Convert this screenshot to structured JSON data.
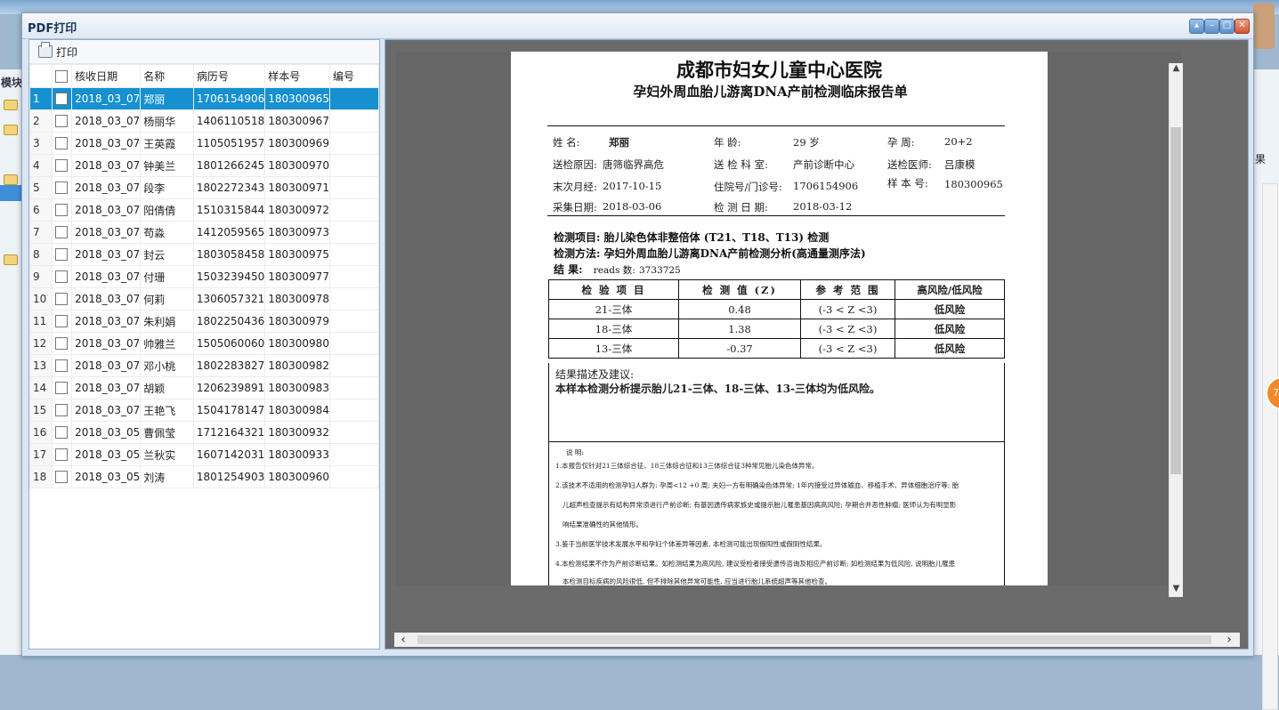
{
  "window": {
    "title": "PDF打印"
  },
  "background": {
    "module_label": "模块",
    "right_tab": "果",
    "badge": "78"
  },
  "toolbar": {
    "print_label": "打印"
  },
  "grid": {
    "columns": [
      "核收日期",
      "名称",
      "病历号",
      "样本号",
      "编号"
    ],
    "rows": [
      {
        "n": "1",
        "date": "2018_03_07",
        "name": "郑丽",
        "record": "1706154906",
        "sample": "180300965",
        "no": ""
      },
      {
        "n": "2",
        "date": "2018_03_07",
        "name": "杨丽华",
        "record": "1406110518",
        "sample": "180300967",
        "no": ""
      },
      {
        "n": "3",
        "date": "2018_03_07",
        "name": "王英霞",
        "record": "1105051957",
        "sample": "180300969",
        "no": ""
      },
      {
        "n": "4",
        "date": "2018_03_07",
        "name": "钟美兰",
        "record": "1801266245",
        "sample": "180300970",
        "no": ""
      },
      {
        "n": "5",
        "date": "2018_03_07",
        "name": "段李",
        "record": "1802272343",
        "sample": "180300971",
        "no": ""
      },
      {
        "n": "6",
        "date": "2018_03_07",
        "name": "阳倩倩",
        "record": "1510315844",
        "sample": "180300972",
        "no": ""
      },
      {
        "n": "7",
        "date": "2018_03_07",
        "name": "苟淼",
        "record": "1412059565",
        "sample": "180300973",
        "no": ""
      },
      {
        "n": "8",
        "date": "2018_03_07",
        "name": "封云",
        "record": "1803058458",
        "sample": "180300975",
        "no": ""
      },
      {
        "n": "9",
        "date": "2018_03_07",
        "name": "付珊",
        "record": "1503239450",
        "sample": "180300977",
        "no": ""
      },
      {
        "n": "10",
        "date": "2018_03_07",
        "name": "何莉",
        "record": "1306057321",
        "sample": "180300978",
        "no": ""
      },
      {
        "n": "11",
        "date": "2018_03_07",
        "name": "朱利娟",
        "record": "1802250436",
        "sample": "180300979",
        "no": ""
      },
      {
        "n": "12",
        "date": "2018_03_07",
        "name": "帅雅兰",
        "record": "1505060060",
        "sample": "180300980",
        "no": ""
      },
      {
        "n": "13",
        "date": "2018_03_07",
        "name": "邓小桃",
        "record": "1802283827",
        "sample": "180300982",
        "no": ""
      },
      {
        "n": "14",
        "date": "2018_03_07",
        "name": "胡颖",
        "record": "1206239891",
        "sample": "180300983",
        "no": ""
      },
      {
        "n": "15",
        "date": "2018_03_07",
        "name": "王艳飞",
        "record": "1504178147",
        "sample": "180300984",
        "no": ""
      },
      {
        "n": "16",
        "date": "2018_03_05",
        "name": "曹佩莹",
        "record": "1712164321",
        "sample": "180300932",
        "no": ""
      },
      {
        "n": "17",
        "date": "2018_03_05",
        "name": "兰秋实",
        "record": "1607142031",
        "sample": "180300933",
        "no": ""
      },
      {
        "n": "18",
        "date": "2018_03_05",
        "name": "刘涛",
        "record": "1801254903",
        "sample": "180300960",
        "no": ""
      }
    ]
  },
  "report": {
    "hospital": "成都市妇女儿童中心医院",
    "title": "孕妇外周血胎儿游离DNA产前检测临床报告单",
    "fields": {
      "name_label": "姓    名:",
      "name": "郑丽",
      "age_label": "年      龄:",
      "age": "29 岁",
      "gest_label": "孕    周:",
      "gest": "20+2",
      "reason_label": "送检原因:",
      "reason": "唐筛临界高危",
      "dept_label": "送 检 科 室:",
      "dept": "产前诊断中心",
      "doctor_label": "送检医师:",
      "doctor": "吕康模",
      "lmp_label": "末次月经:",
      "lmp": "2017-10-15",
      "inpatient_label": "住院号/门诊号:",
      "inpatient": "1706154906",
      "sample_label": "样 本 号:",
      "sample": "180300965",
      "collect_label": "采集日期:",
      "collect": "2018-03-06",
      "test_date_label": "检 测 日 期:",
      "test_date": "2018-03-12"
    },
    "project_label": "检测项目:",
    "project": "胎儿染色体非整倍体 (T21、T18、T13) 检测",
    "method_label": "检测方法:",
    "method": "孕妇外周血胎儿游离DNA产前检测分析(高通量测序法)",
    "result_label": "结      果:",
    "reads_label": "reads 数:",
    "reads": "3733725",
    "table": {
      "headers": [
        "检 验 项 目",
        "检 测 值 (Z)",
        "参 考 范 围",
        "高风险/低风险"
      ],
      "rows": [
        {
          "item": "21-三体",
          "value": "0.48",
          "range": "(-3 < Z <3)",
          "risk": "低风险"
        },
        {
          "item": "18-三体",
          "value": "1.38",
          "range": "(-3 < Z <3)",
          "risk": "低风险"
        },
        {
          "item": "13-三体",
          "value": "-0.37",
          "range": "(-3 < Z <3)",
          "risk": "低风险"
        }
      ]
    },
    "desc_label": "结果描述及建议:",
    "desc": "本样本检测分析提示胎儿21-三体、18-三体、13-三体均为低风险。",
    "notes_label": "说    明:",
    "notes": [
      "1.本报告仅针对21三体综合征、18三体综合征和13三体综合征3种常见胎儿染色体异常。",
      "2.该技术不适用的检测孕妇人群为: 孕周<12 +0 周; 夫妇一方有明确染色体异常; 1年内接受过异体输血、移植手术、异体细胞治疗等; 胎",
      "儿超声检查提示有结构异常须进行产前诊断; 有基因遗传病家族史或提示胎儿罹患基因病高风险; 孕期合并恶性肿瘤; 医师认为有明显影",
      "响结果准确性的其他情形。",
      "3.鉴于当前医学技术发展水平和孕妇个体差异等因素, 本检测可能出现假阳性或假阴性结果。",
      "4.本检测结果不作为产前诊断结果。如检测结果为高风险, 建议受检者接受遗传咨询及相应产前诊断; 如检测结果为低风险, 说明胎儿罹患",
      "本检测目标疾病的风险很低, 但不排除其他异常可能性, 应当进行胎儿系统超声等其他检查。"
    ]
  }
}
